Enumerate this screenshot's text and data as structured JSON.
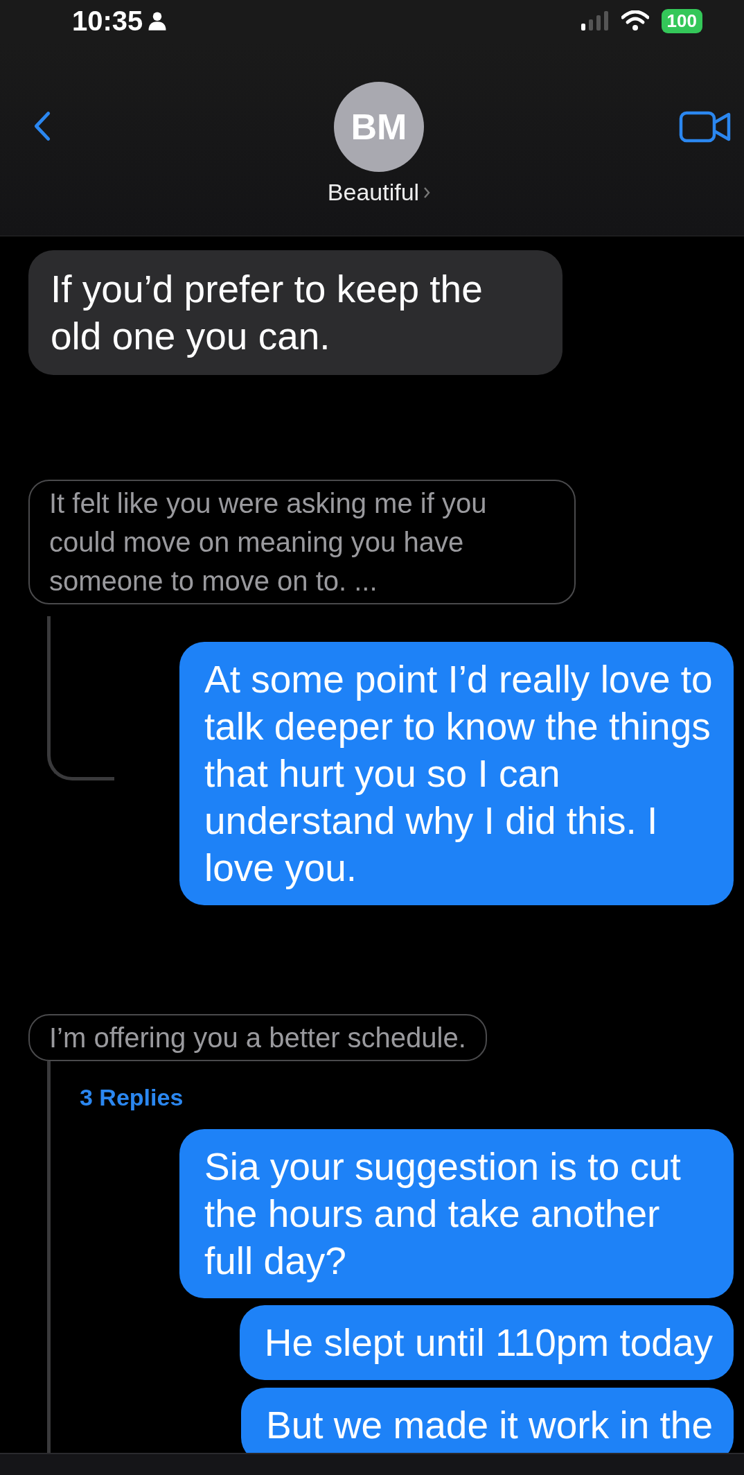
{
  "status_bar": {
    "time": "10:35",
    "battery": "100"
  },
  "header": {
    "avatar_initials": "BM",
    "contact_name": "Beautiful"
  },
  "messages": [
    {
      "kind": "received",
      "text": "If you’d prefer to keep the old one you can."
    },
    {
      "kind": "quoted",
      "text": "It felt like you were asking me if you could move on meaning you have someone to move on to. ..."
    },
    {
      "kind": "sent",
      "reply_connector": true,
      "text": "At some point I’d really love to talk deeper to know the things that hurt you so I can understand why I did this. I love you."
    },
    {
      "kind": "quoted",
      "text": "I’m offering you a better schedule."
    },
    {
      "kind": "replies",
      "in_thread": true,
      "text": "3 Replies"
    },
    {
      "kind": "sent",
      "in_thread": true,
      "text": "Sia your suggestion is to cut the hours and take another full day?"
    },
    {
      "kind": "sent",
      "in_thread": true,
      "text": "He slept until 110pm today"
    },
    {
      "kind": "sent",
      "in_thread": true,
      "text": "But we made it work in the"
    }
  ]
}
